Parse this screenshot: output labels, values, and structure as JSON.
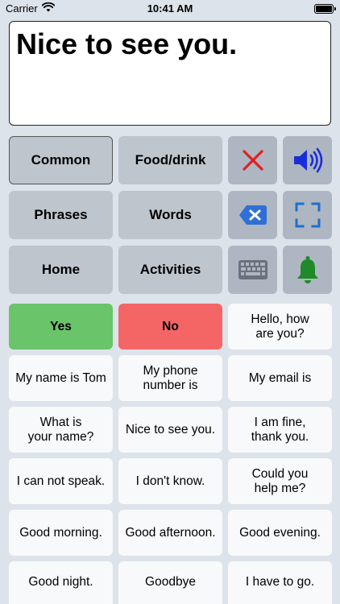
{
  "status_bar": {
    "carrier": "Carrier",
    "time": "10:41 AM"
  },
  "message_box": {
    "text": "Nice to see you."
  },
  "categories": [
    {
      "label": "Common"
    },
    {
      "label": "Food/drink"
    },
    {
      "label": "Phrases"
    },
    {
      "label": "Words"
    },
    {
      "label": "Home"
    },
    {
      "label": "Activities"
    }
  ],
  "tools": {
    "clear": "close-icon",
    "speak": "speaker-icon",
    "backspace": "backspace-icon",
    "fullscreen": "fullscreen-icon",
    "keyboard": "keyboard-icon",
    "alert": "bell-icon"
  },
  "colors": {
    "background": "#dde3ea",
    "category": "#bfc5cc",
    "tool": "#aeb6c2",
    "phrase": "#f8f9fa",
    "yes": "#6ac46a",
    "no": "#f46666",
    "speaker_blue": "#1a2ed8",
    "bell_green": "#1f8a2a",
    "close_red": "#e02020"
  },
  "phrases": [
    [
      "Yes",
      "No",
      "Hello, how\nare you?"
    ],
    [
      "My name is Tom",
      "My phone\nnumber is",
      "My email is"
    ],
    [
      "What is\nyour name?",
      "Nice to see you.",
      "I am fine,\nthank you."
    ],
    [
      "I can not speak.",
      "I don't know.",
      "Could you\nhelp me?"
    ],
    [
      "Good morning.",
      "Good afternoon.",
      "Good evening."
    ],
    [
      "Good night.",
      "Goodbye",
      "I have to go."
    ]
  ]
}
